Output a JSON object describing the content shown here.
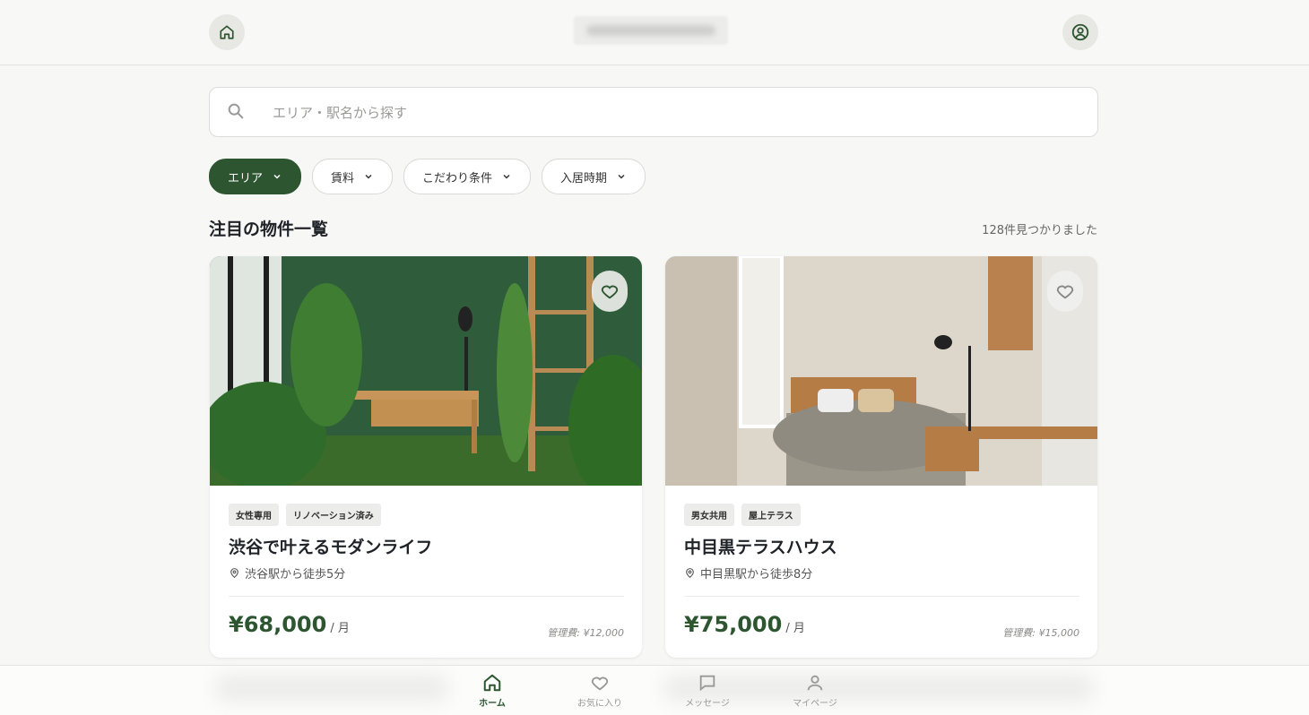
{
  "header": {
    "home_icon": "home-icon",
    "profile_icon": "user-circle-icon"
  },
  "search": {
    "placeholder": "エリア・駅名から探す"
  },
  "filters": [
    "エリア",
    "賃料",
    "こだわり条件",
    "入居時期"
  ],
  "section": {
    "title": "注目の物件一覧",
    "count": "128件見つかりました"
  },
  "listings": [
    {
      "tags": [
        "女性専用",
        "リノベーション済み"
      ],
      "title": "渋谷で叶えるモダンライフ",
      "location": "渋谷駅から徒歩5分",
      "price": "¥68,000",
      "unit": "/ 月",
      "fee": "管理費: ¥12,000"
    },
    {
      "tags": [
        "男女共用",
        "屋上テラス"
      ],
      "title": "中目黒テラスハウス",
      "location": "中目黒駅から徒歩8分",
      "price": "¥75,000",
      "unit": "/ 月",
      "fee": "管理費: ¥15,000"
    }
  ],
  "nav": [
    "ホーム",
    "お気に入り",
    "メッセージ",
    "マイページ"
  ],
  "colors": {
    "accent": "#2c5530",
    "background": "#f7f7f6"
  }
}
